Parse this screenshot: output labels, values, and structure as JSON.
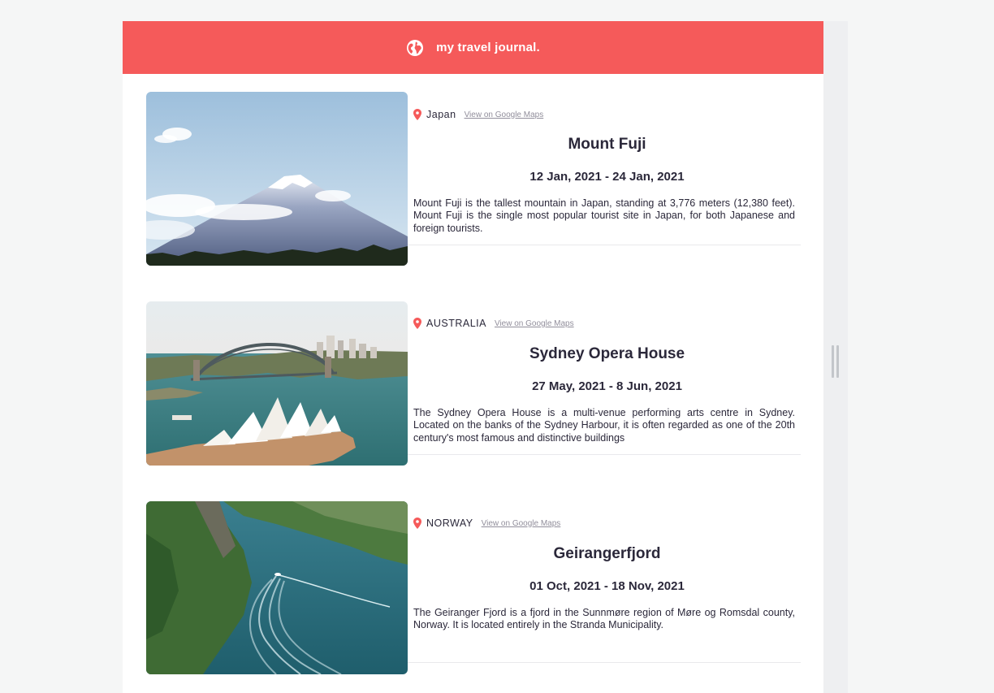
{
  "header": {
    "title": "my travel journal.",
    "icon": "globe-icon",
    "background": "#f55a5a"
  },
  "entries": [
    {
      "country": "Japan",
      "maps_link": "View on Google Maps",
      "title": "Mount Fuji",
      "dates": "12 Jan, 2021 - 24 Jan, 2021",
      "description": "Mount Fuji is the tallest mountain in Japan, standing at 3,776 meters (12,380 feet). Mount Fuji is the single most popular tourist site in Japan, for both Japanese and foreign tourists."
    },
    {
      "country": "AUSTRALIA",
      "maps_link": "View on Google Maps",
      "title": "Sydney Opera House",
      "dates": "27 May, 2021 - 8 Jun, 2021",
      "description": "The Sydney Opera House is a multi-venue performing arts centre in Sydney. Located on the banks of the Sydney Harbour, it is often regarded as one of the 20th century's most famous and distinctive buildings"
    },
    {
      "country": "NORWAY",
      "maps_link": "View on Google Maps",
      "title": "Geirangerfjord",
      "dates": "01 Oct, 2021 - 18 Nov, 2021",
      "description": "The Geiranger Fjord is a fjord in the Sunnmøre region of Møre og Romsdal county, Norway. It is located entirely in the Stranda Municipality."
    }
  ],
  "colors": {
    "accent": "#f55a5a",
    "text": "#2b283a",
    "link": "#918e9b"
  }
}
